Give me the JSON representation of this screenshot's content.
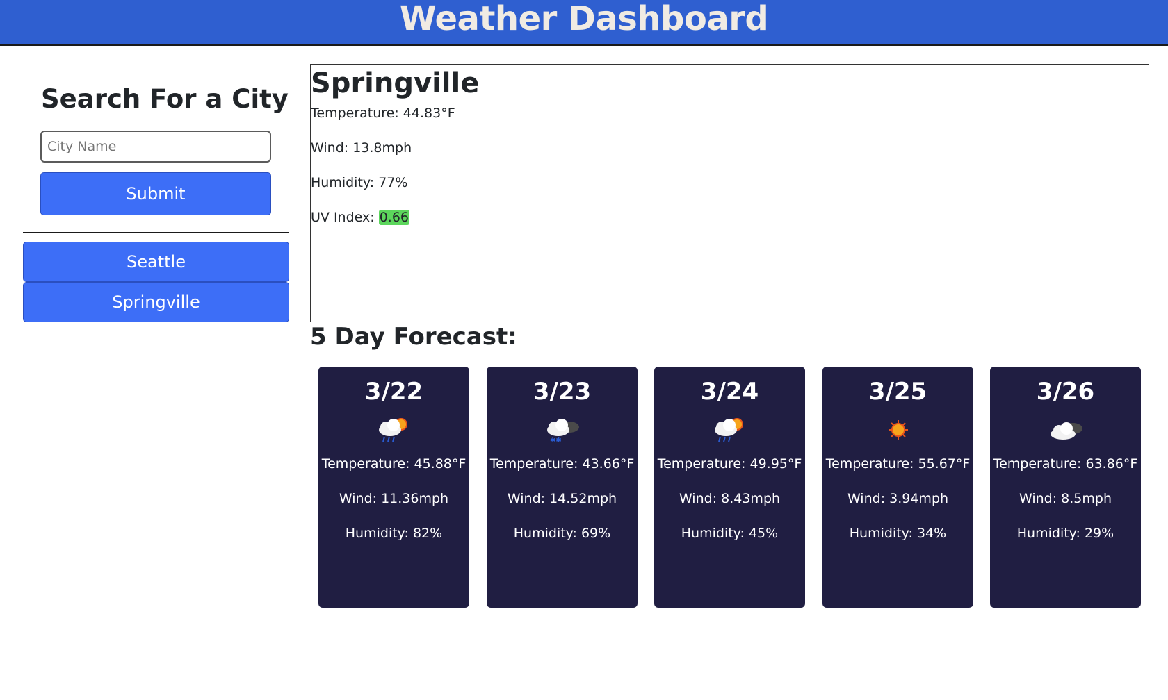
{
  "header": {
    "title": "Weather Dashboard"
  },
  "sidebar": {
    "title": "Search For a City",
    "input_placeholder": "City Name",
    "input_value": "",
    "submit_label": "Submit",
    "history": [
      "Seattle",
      "Springville"
    ]
  },
  "current": {
    "city": "Springville",
    "temperature": "Temperature: 44.83°F",
    "wind": "Wind: 13.8mph",
    "humidity": "Humidity: 77%",
    "uv_label": "UV Index: ",
    "uv_value": "0.66",
    "uv_color": "#5cd65c"
  },
  "forecast": {
    "title": "5 Day Forecast:",
    "days": [
      {
        "date": "3/22",
        "icon": "rain-sun-icon",
        "temp": "Temperature: 45.88°F",
        "wind": "Wind: 11.36mph",
        "humidity": "Humidity: 82%"
      },
      {
        "date": "3/23",
        "icon": "snow-cloud-icon",
        "temp": "Temperature: 43.66°F",
        "wind": "Wind: 14.52mph",
        "humidity": "Humidity: 69%"
      },
      {
        "date": "3/24",
        "icon": "rain-sun-icon",
        "temp": "Temperature: 49.95°F",
        "wind": "Wind: 8.43mph",
        "humidity": "Humidity: 45%"
      },
      {
        "date": "3/25",
        "icon": "sun-icon",
        "temp": "Temperature: 55.67°F",
        "wind": "Wind: 3.94mph",
        "humidity": "Humidity: 34%"
      },
      {
        "date": "3/26",
        "icon": "cloud-icon",
        "temp": "Temperature: 63.86°F",
        "wind": "Wind: 8.5mph",
        "humidity": "Humidity: 29%"
      }
    ]
  },
  "colors": {
    "header_bg": "#2f5fd0",
    "header_text": "#f0ebe3",
    "button_bg": "#3d6ef7",
    "card_bg": "#201e42"
  }
}
